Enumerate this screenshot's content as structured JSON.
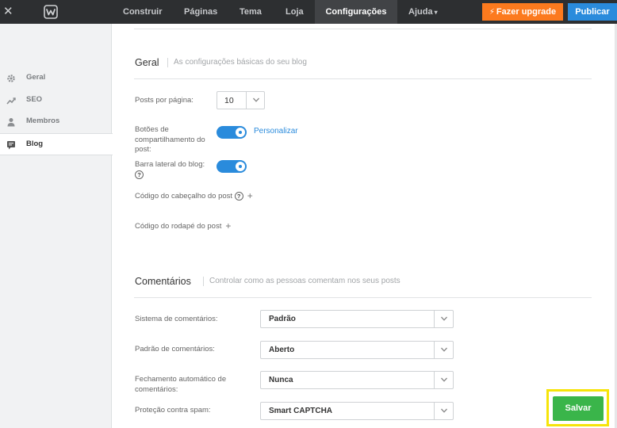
{
  "topbar": {
    "close_glyph": "✕",
    "nav": [
      "Construir",
      "Páginas",
      "Tema",
      "Loja",
      "Configurações",
      "Ajuda"
    ],
    "active_nav": "Configurações",
    "upgrade_label": "Fazer upgrade",
    "publish_label": "Publicar"
  },
  "sidebar": {
    "items": [
      {
        "label": "Geral",
        "icon": "gear-icon"
      },
      {
        "label": "SEO",
        "icon": "trend-icon"
      },
      {
        "label": "Membros",
        "icon": "person-icon"
      },
      {
        "label": "Blog",
        "icon": "blog-icon"
      }
    ],
    "active": "Blog"
  },
  "geral": {
    "title": "Geral",
    "description": "As configurações básicas do seu blog",
    "posts_per_page_label": "Posts por página:",
    "posts_per_page_value": "10",
    "share_buttons_label": "Botões de compartilhamento do post:",
    "share_buttons_on": true,
    "customize_link": "Personalizar",
    "sidebar_label": "Barra lateral do blog:",
    "sidebar_on": true,
    "help_glyph": "?",
    "plus_glyph": "+",
    "header_code_label": "Código do cabeçalho do post",
    "footer_code_label": "Código do rodapé do post"
  },
  "comentarios": {
    "title": "Comentários",
    "description": "Controlar como as pessoas comentam nos seus posts",
    "system_label": "Sistema de comentários:",
    "system_value": "Padrão",
    "default_label": "Padrão de comentários:",
    "default_value": "Aberto",
    "auto_close_label": "Fechamento automático de comentários:",
    "auto_close_value": "Nunca",
    "spam_label": "Proteção contra spam:",
    "spam_value": "Smart CAPTCHA"
  },
  "save_label": "Salvar",
  "colors": {
    "topbar": "#2d2f31",
    "upgrade": "#fc7a1e",
    "publish": "#2a8bdc",
    "toggle": "#2a8bdc",
    "save": "#3ab54a",
    "highlight": "#f6e40a"
  }
}
